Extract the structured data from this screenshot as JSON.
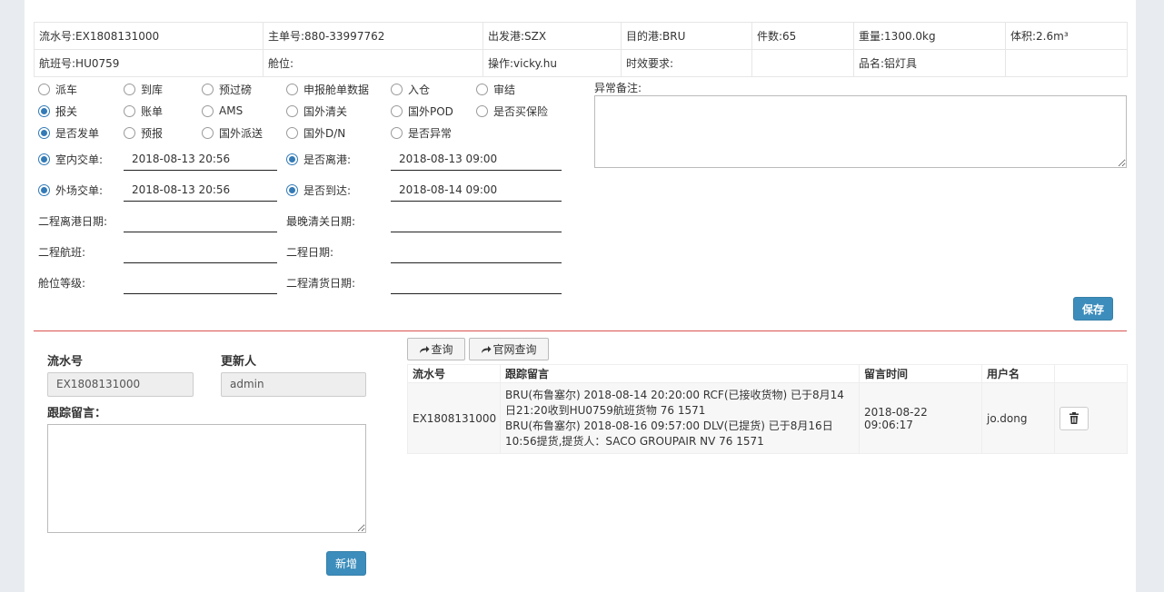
{
  "info": {
    "row1": [
      "流水号:EX1808131000",
      "主单号:880-33997762",
      "出发港:SZX",
      "目的港:BRU",
      "件数:65",
      "重量:1300.0kg",
      "体积:2.6m³"
    ],
    "row2": [
      "航班号:HU0759",
      "舱位:",
      "操作:vicky.hu",
      "时效要求:",
      "",
      "品名:铝灯具",
      ""
    ]
  },
  "options": {
    "row1": [
      {
        "label": "派车",
        "checked": false
      },
      {
        "label": "到库",
        "checked": false
      },
      {
        "label": "预过磅",
        "checked": false
      },
      {
        "label": "申报舱单数据",
        "checked": false
      },
      {
        "label": "入仓",
        "checked": false
      },
      {
        "label": "审结",
        "checked": false
      }
    ],
    "row2": [
      {
        "label": "报关",
        "checked": true
      },
      {
        "label": "账单",
        "checked": false
      },
      {
        "label": "AMS",
        "checked": false
      },
      {
        "label": "国外清关",
        "checked": false
      },
      {
        "label": "国外POD",
        "checked": false
      },
      {
        "label": "是否买保险",
        "checked": false
      }
    ],
    "row3": [
      {
        "label": "是否发单",
        "checked": true
      },
      {
        "label": "预报",
        "checked": false
      },
      {
        "label": "国外派送",
        "checked": false
      },
      {
        "label": "国外D/N",
        "checked": false
      },
      {
        "label": "是否异常",
        "checked": false
      }
    ]
  },
  "dates": {
    "indoor": {
      "label": "室内交单:",
      "value": "2018-08-13 20:56"
    },
    "departed": {
      "label": "是否离港:",
      "value": "2018-08-13 09:00"
    },
    "outdoor": {
      "label": "外场交单:",
      "value": "2018-08-13 20:56"
    },
    "arrived": {
      "label": "是否到达:",
      "value": "2018-08-14 09:00"
    },
    "second_depart": {
      "label": "二程离港日期:",
      "value": ""
    },
    "latest_clear": {
      "label": "最晚清关日期:",
      "value": ""
    },
    "second_flight": {
      "label": "二程航班:",
      "value": ""
    },
    "second_date": {
      "label": "二程日期:",
      "value": ""
    },
    "cabin_level": {
      "label": "舱位等级:",
      "value": ""
    },
    "second_clear": {
      "label": "二程清货日期:",
      "value": ""
    }
  },
  "remark": {
    "label": "异常备注:",
    "value": ""
  },
  "save_label": "保存",
  "tracking_form": {
    "serial_label": "流水号",
    "serial_value": "EX1808131000",
    "updater_label": "更新人",
    "updater_value": "admin",
    "message_label": "跟踪留言：",
    "message_value": "",
    "add_label": "新增"
  },
  "log_toolbar": {
    "query_label": "查询",
    "web_query_label": "官网查询"
  },
  "log_table": {
    "headers": [
      "流水号",
      "跟踪留言",
      "留言时间",
      "用户名",
      ""
    ],
    "rows": [
      {
        "serial": "EX1808131000",
        "message_line1": "BRU(布鲁塞尔) 2018-08-14 20:20:00 RCF(已接收货物) 已于8月14日21:20收到HU0759航班货物 76 1571",
        "message_line2": "BRU(布鲁塞尔) 2018-08-16 09:57:00 DLV(已提货) 已于8月16日10:56提货,提货人：SACO GROUPAIR NV 76 1571",
        "time": "2018-08-22 09:06:17",
        "user": "jo.dong",
        "delete_icon": "trash-icon"
      }
    ]
  },
  "colors": {
    "primary": "#3c8dbc",
    "divider": "#d9534f",
    "radio_checked": "#337ab7"
  }
}
